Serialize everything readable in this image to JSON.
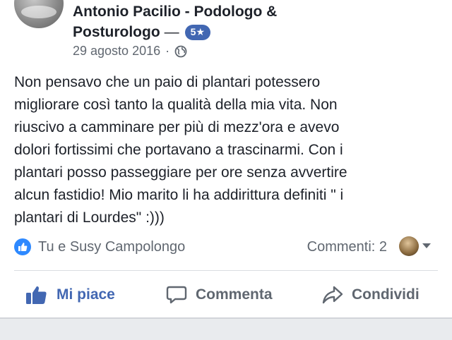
{
  "post": {
    "author_line1": "Antonio Pacilio - Podologo &",
    "author_line2": "Posturologo",
    "dash": "—",
    "rating": "5★",
    "date": "29 agosto 2016",
    "separator": "·",
    "privacy_icon": "globe-icon",
    "text": "Non pensavo che un paio di plantari potessero\nmigliorare così tanto la qualità della mia vita. Non\nriuscivo a camminare per più di mezz'ora e avevo\ndolori fortissimi che portavano a trascinarmi. Con i\nplantari posso passeggiare per ore senza avvertire\nalcun fastidio! Mio marito li ha addirittura definiti \" i\nplantari di Lourdes\" :)))"
  },
  "reactions": {
    "icon": "like-icon",
    "text": "Tu e Susy Campolongo",
    "comments": "Commenti: 2"
  },
  "actions": {
    "like": "Mi piace",
    "comment": "Commenta",
    "share": "Condividi"
  },
  "colors": {
    "accent": "#4267b2",
    "like_badge": "#2e89ff",
    "secondary_text": "#606770"
  }
}
